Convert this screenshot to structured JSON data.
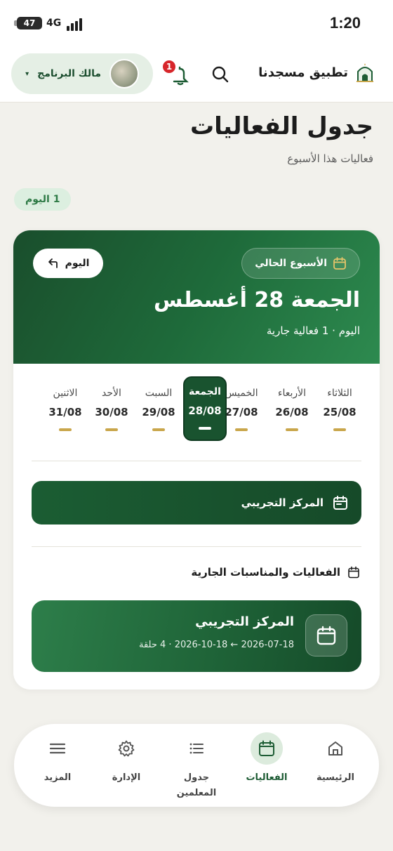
{
  "status_bar": {
    "battery": "47",
    "network": "4G",
    "time": "1:20"
  },
  "header": {
    "app_name": "تطبيق مسجدنا",
    "notification_count": "1",
    "user_name": "مالك البرنامج",
    "user_caret": "▾"
  },
  "page": {
    "title": "جدول الفعاليات",
    "subtitle": "فعاليات هذا الأسبوع",
    "today_count": "1 اليوم"
  },
  "hero": {
    "week_label": "الأسبوع الحالي",
    "today_button": "اليوم",
    "date_heading": "الجمعة 28 أغسطس",
    "summary": "اليوم · 1 فعالية جارية"
  },
  "days": [
    {
      "name": "الثلاثاء",
      "date": "25/08",
      "selected": false
    },
    {
      "name": "الأربعاء",
      "date": "26/08",
      "selected": false
    },
    {
      "name": "الخميس",
      "date": "27/08",
      "selected": false
    },
    {
      "name": "الجمعة",
      "date": "28/08",
      "selected": true
    },
    {
      "name": "السبت",
      "date": "29/08",
      "selected": false
    },
    {
      "name": "الأحد",
      "date": "30/08",
      "selected": false
    },
    {
      "name": "الاثنين",
      "date": "31/08",
      "selected": false
    }
  ],
  "center": {
    "name": "المركز التجريبي"
  },
  "events_section": {
    "heading": "الفعاليات والمناسبات الجارية",
    "event": {
      "title": "المركز التجريبي",
      "meta": "2026-07-18 ← 2026-10-18 · 4 حلقة"
    }
  },
  "bottom_nav": [
    {
      "label": "الرئيسية",
      "icon": "home-icon",
      "active": false
    },
    {
      "label": "الفعاليات",
      "icon": "calendar-icon",
      "active": true
    },
    {
      "label": "جدول المعلمين",
      "icon": "list-icon",
      "active": false
    },
    {
      "label": "الإدارة",
      "icon": "gear-icon",
      "active": false
    },
    {
      "label": "المزيد",
      "icon": "menu-icon",
      "active": false
    }
  ],
  "colors": {
    "primary_green": "#1b5d33",
    "accent_gold": "#c9a64b",
    "badge_red": "#d7262b",
    "background": "#f2f1ec"
  }
}
